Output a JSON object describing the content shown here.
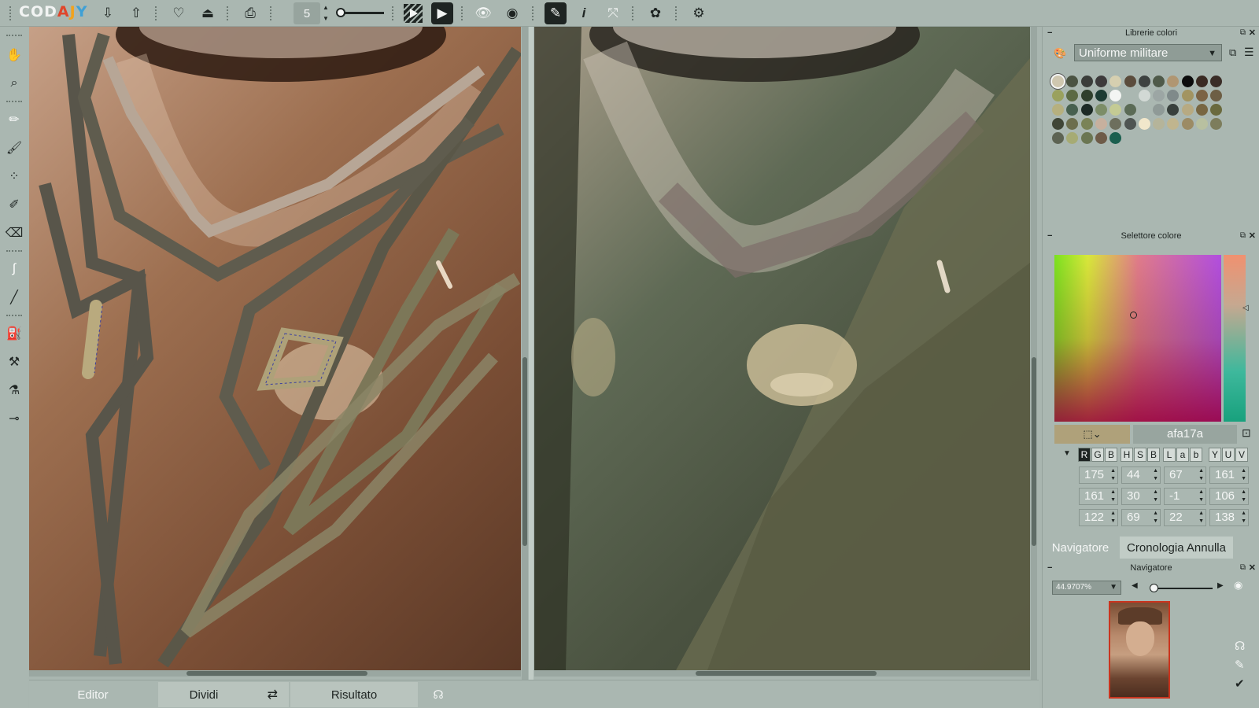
{
  "app": {
    "logo": "CODAJY"
  },
  "toolbar": {
    "brush_size": "5",
    "icons": [
      "import-icon",
      "export-icon",
      "hint-icon",
      "export-hints-icon",
      "print-icon",
      "preview-icon",
      "play-icon",
      "eye-icon",
      "eye-hint-icon",
      "pen-icon",
      "info-icon",
      "fit-icon",
      "settings-icon",
      "settings-gear-icon"
    ]
  },
  "tools": [
    "hand-icon",
    "zoom-icon",
    "pencil-icon",
    "brush-icon",
    "dots-brush-icon",
    "marker-icon",
    "eraser-icon",
    "smudge-icon",
    "line-icon",
    "bucket-icon",
    "stamp-icon",
    "dropper-brush-icon",
    "eyedropper-icon"
  ],
  "bottombar": {
    "editor": "Editor",
    "split": "Dividi",
    "result": "Risultato"
  },
  "palette_panel": {
    "title": "Librerie colori",
    "selected": "Uniforme militare",
    "swatches": [
      "#cfc7b0",
      "#4b5342",
      "#3b3d3a",
      "#3d3a3b",
      "#d6cfb0",
      "#5b4c3c",
      "#3d4240",
      "#4f5a49",
      "#b09672",
      "#0c0c0c",
      "#3a2a22",
      "#3a2d27",
      "#9aa15e",
      "#5c6a44",
      "#2f3f2c",
      "#1c3b33",
      "#f3f5f3",
      "#aab7b1",
      "#d2d9d5",
      "#9ca6a4",
      "#7f8a8a",
      "#a29461",
      "#7b6344",
      "#6d5e44",
      "#b6b07f",
      "#47604f",
      "#1c2a25",
      "#7c8d68",
      "#c4cb94",
      "#5b6b56",
      "#aab7b1",
      "#8f9a97",
      "#38403c",
      "#b7aa82",
      "#786642",
      "#6a6a3e",
      "#3f4536",
      "#6c6e4d",
      "#7a8357",
      "#c7b09e",
      "#6d6f5d",
      "#4f5552",
      "#f1e7cb",
      "#b5b49a",
      "#c0b58e",
      "#9c8b64",
      "#b8c0a0",
      "#7d7d5c",
      "#5d6353",
      "#a6ab74",
      "#6b7652",
      "#6e5b48",
      "#1b5f4f"
    ]
  },
  "color_panel": {
    "title": "Selettore colore",
    "hex": "afa17a",
    "current_color": "#afa17a",
    "headers": {
      "rgb": [
        "R",
        "G",
        "B"
      ],
      "hsb": [
        "H",
        "S",
        "B"
      ],
      "lab": [
        "L",
        "a",
        "b"
      ],
      "yuv": [
        "Y",
        "U",
        "V"
      ]
    },
    "values": {
      "rgb": [
        "175",
        "161",
        "122"
      ],
      "hsb": [
        "44",
        "30",
        "69"
      ],
      "lab": [
        "67",
        "-1",
        "22"
      ],
      "yuv": [
        "161",
        "106",
        "138"
      ]
    }
  },
  "navigator": {
    "tab_navigator": "Navigatore",
    "tab_history": "Cronologia Annulla",
    "title": "Navigatore",
    "zoom": "44.9707%"
  }
}
